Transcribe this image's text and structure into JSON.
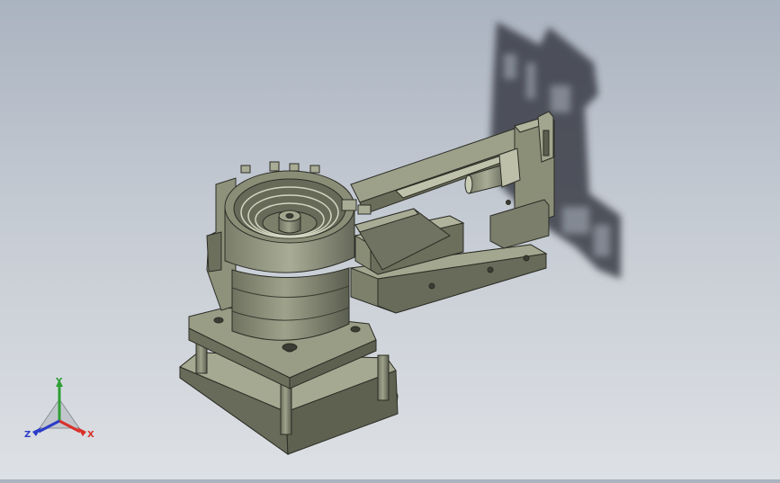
{
  "viewport": {
    "model": "vibratory-bowl-feeder-assembly",
    "background_top": "#aab3c0",
    "background_bottom": "#dde0e4",
    "part_color": "#8d9079",
    "part_dark": "#5f6252",
    "shadow_color": "#3a3e46"
  },
  "triad": {
    "x_label": "X",
    "y_label": "Y",
    "z_label": "Z",
    "x_color": "#d9302a",
    "y_color": "#2e9e35",
    "z_color": "#2a3cc8"
  }
}
